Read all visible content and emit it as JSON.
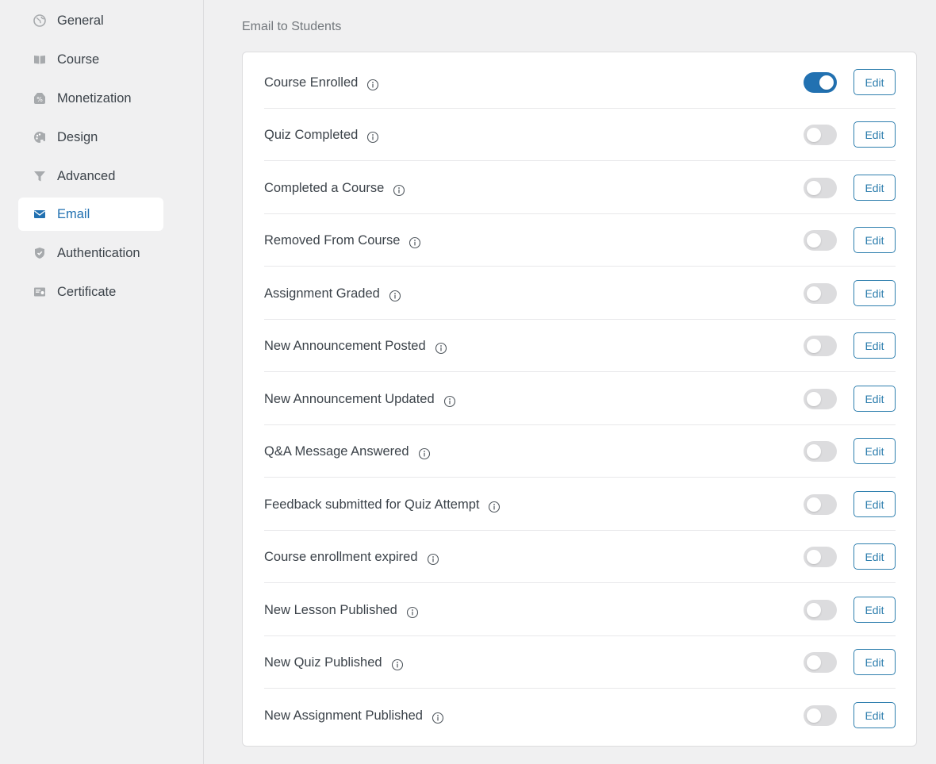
{
  "sidebar": {
    "items": [
      {
        "label": "General",
        "icon": "globe-icon",
        "active": false
      },
      {
        "label": "Course",
        "icon": "book-icon",
        "active": false
      },
      {
        "label": "Monetization",
        "icon": "money-tag-icon",
        "active": false
      },
      {
        "label": "Design",
        "icon": "palette-icon",
        "active": false
      },
      {
        "label": "Advanced",
        "icon": "filter-icon",
        "active": false
      },
      {
        "label": "Email",
        "icon": "envelope-icon",
        "active": true
      },
      {
        "label": "Authentication",
        "icon": "shield-icon",
        "active": false
      },
      {
        "label": "Certificate",
        "icon": "certificate-icon",
        "active": false
      }
    ]
  },
  "main": {
    "section_title": "Email to Students",
    "rows": [
      {
        "label": "Course Enrolled",
        "enabled": true,
        "edit_label": "Edit"
      },
      {
        "label": "Quiz Completed",
        "enabled": false,
        "edit_label": "Edit"
      },
      {
        "label": "Completed a Course",
        "enabled": false,
        "edit_label": "Edit"
      },
      {
        "label": "Removed From Course",
        "enabled": false,
        "edit_label": "Edit"
      },
      {
        "label": "Assignment Graded",
        "enabled": false,
        "edit_label": "Edit"
      },
      {
        "label": "New Announcement Posted",
        "enabled": false,
        "edit_label": "Edit"
      },
      {
        "label": "New Announcement Updated",
        "enabled": false,
        "edit_label": "Edit"
      },
      {
        "label": "Q&A Message Answered",
        "enabled": false,
        "edit_label": "Edit"
      },
      {
        "label": "Feedback submitted for Quiz Attempt",
        "enabled": false,
        "edit_label": "Edit"
      },
      {
        "label": "Course enrollment expired",
        "enabled": false,
        "edit_label": "Edit"
      },
      {
        "label": "New Lesson Published",
        "enabled": false,
        "edit_label": "Edit"
      },
      {
        "label": "New Quiz Published",
        "enabled": false,
        "edit_label": "Edit"
      },
      {
        "label": "New Assignment Published",
        "enabled": false,
        "edit_label": "Edit"
      }
    ]
  },
  "colors": {
    "accent": "#2271b1",
    "text": "#3c434a",
    "muted": "#72777c",
    "toggle_off": "#dcdcde",
    "edit_border": "#2f7fae"
  }
}
